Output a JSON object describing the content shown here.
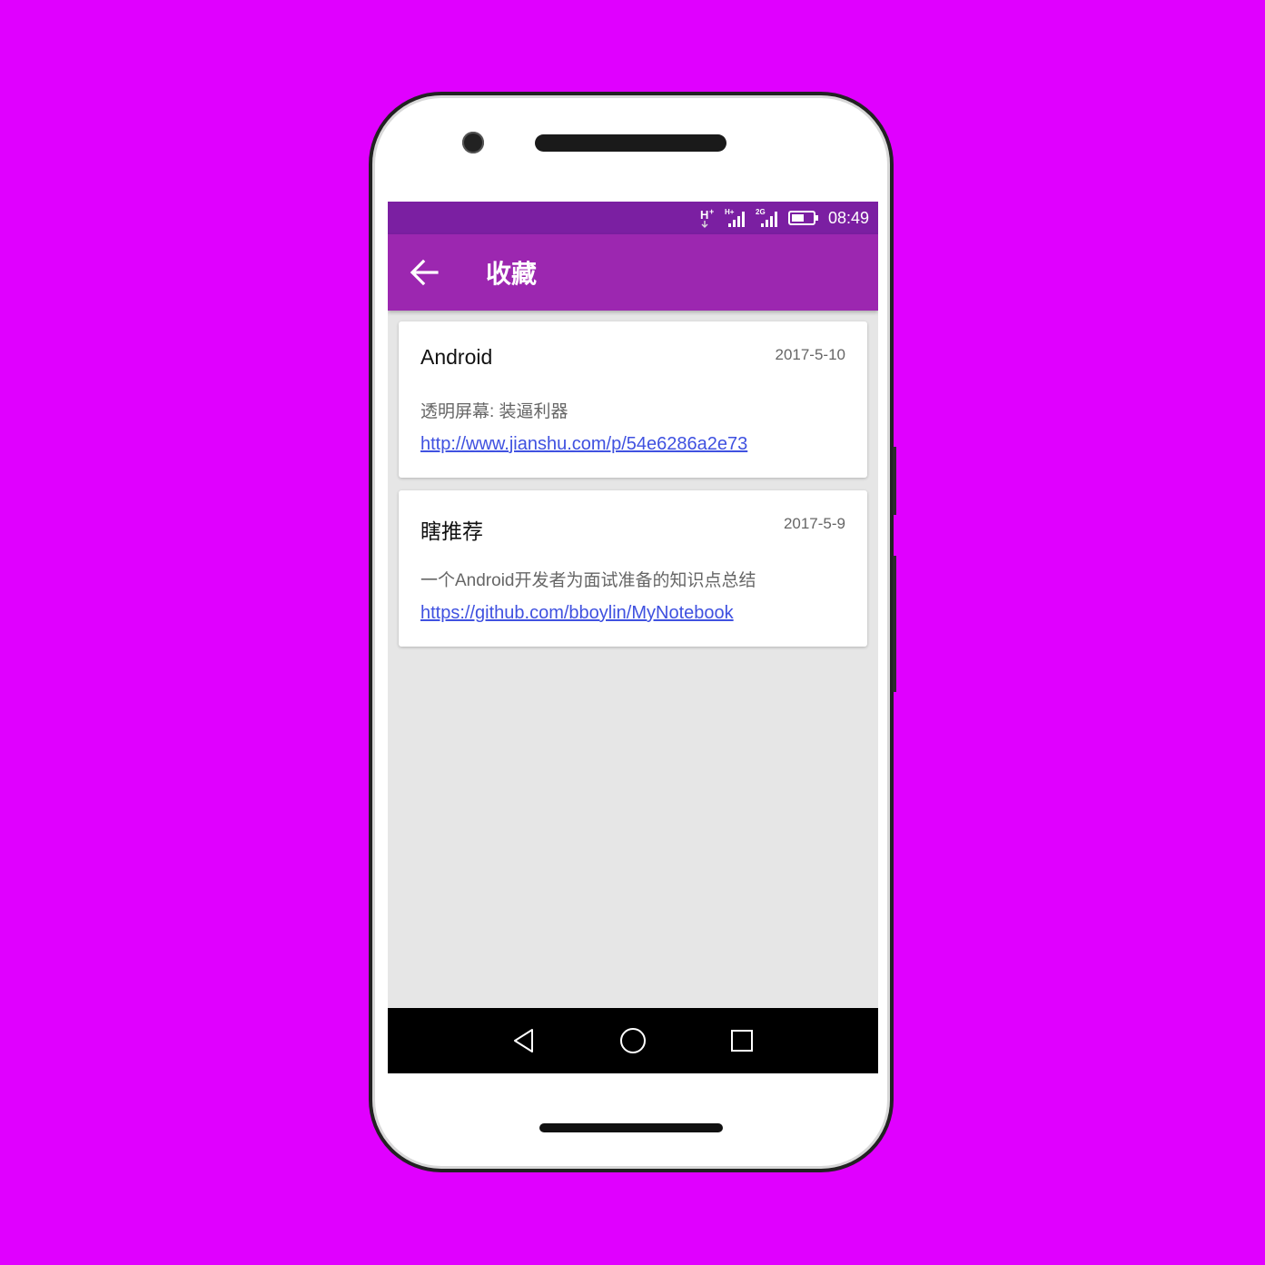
{
  "status_bar": {
    "network_1": "H+",
    "network_2": "H+",
    "network_3": "2G",
    "time": "08:49"
  },
  "toolbar": {
    "title": "收藏",
    "back_icon": "arrow-back-icon"
  },
  "favorites": [
    {
      "title": "Android",
      "date": "2017-5-10",
      "description": "透明屏幕: 装逼利器",
      "url": "http://www.jianshu.com/p/54e6286a2e73"
    },
    {
      "title": "瞎推荐",
      "date": "2017-5-9",
      "description": "一个Android开发者为面试准备的知识点总结",
      "url": "https://github.com/bboylin/MyNotebook"
    }
  ],
  "nav_bar": {
    "back_icon": "triangle-back-icon",
    "home_icon": "circle-home-icon",
    "recents_icon": "square-recents-icon"
  },
  "colors": {
    "background": "#e000ff",
    "status_bar": "#7b1fa2",
    "toolbar": "#9c27b0",
    "link": "#3f51e0",
    "list_background": "#e6e6e6"
  }
}
